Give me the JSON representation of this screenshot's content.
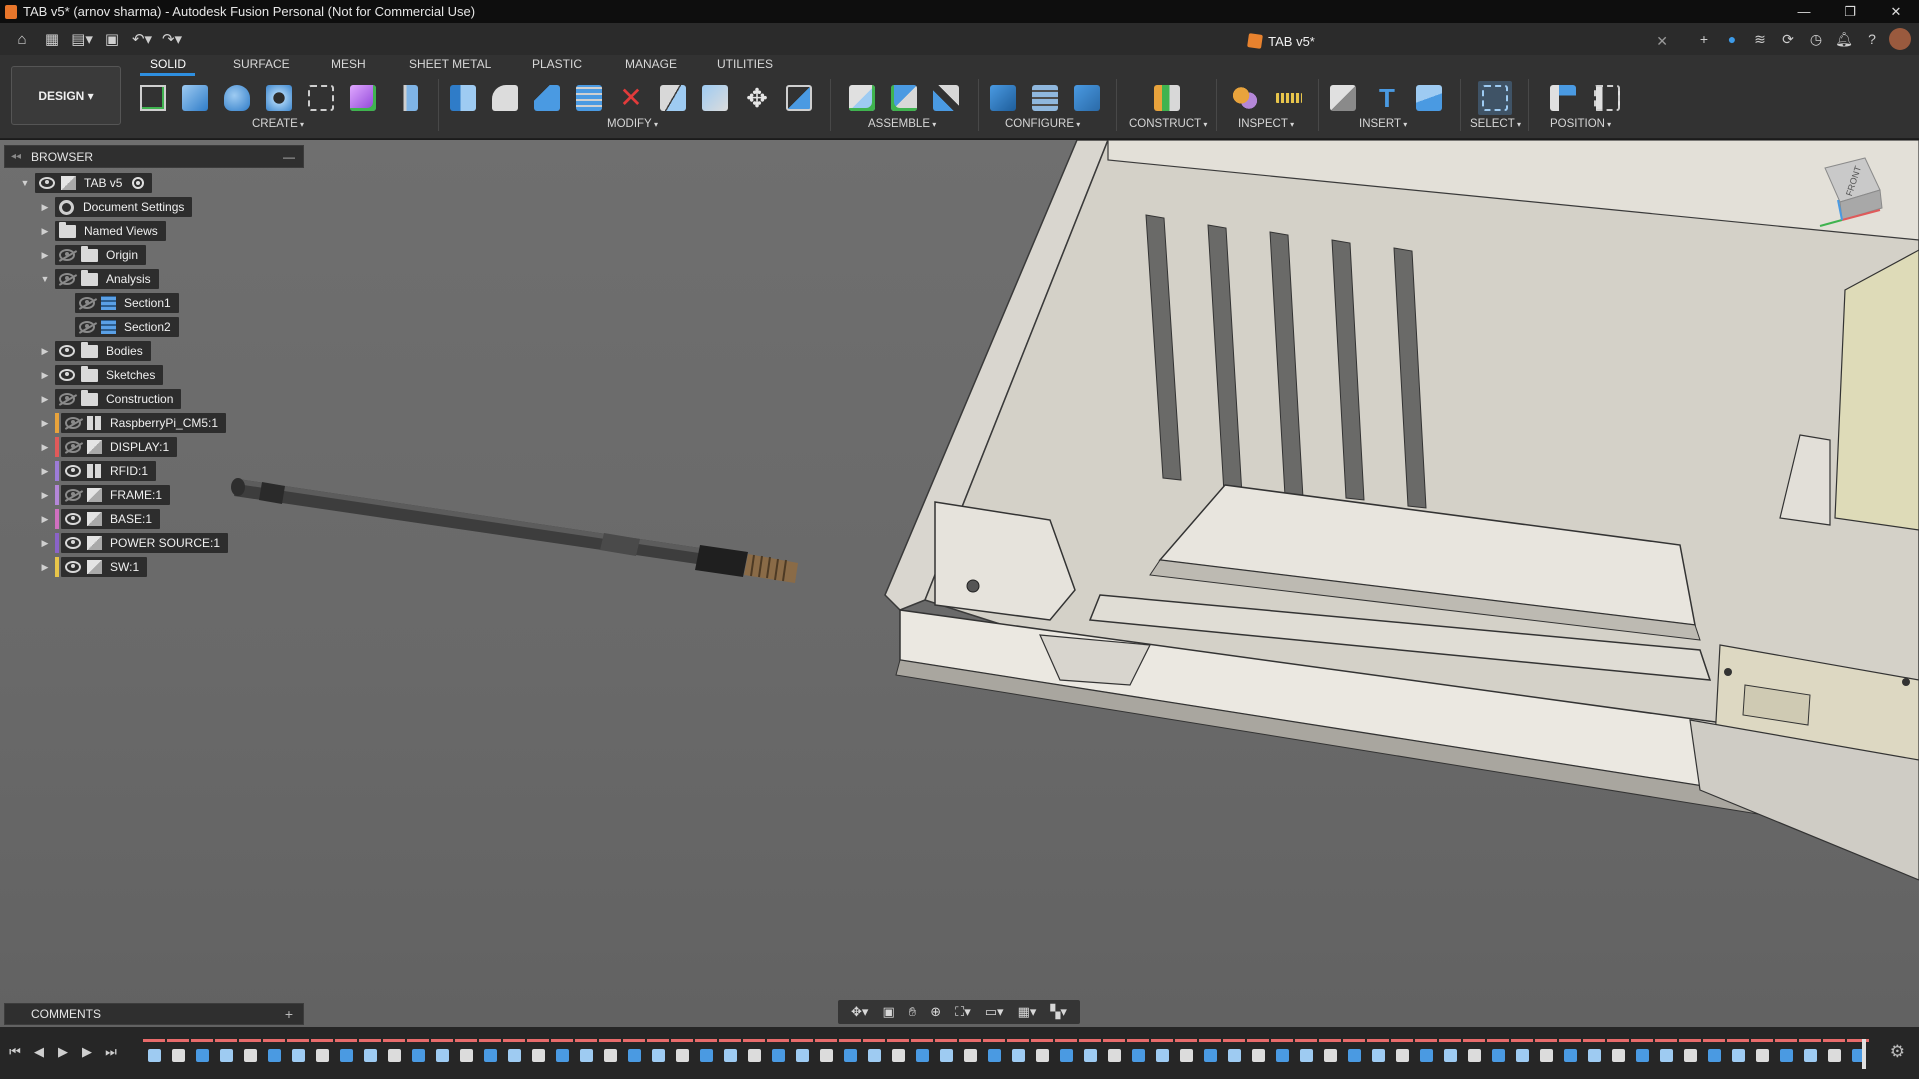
{
  "window": {
    "title": "TAB v5* (arnov sharma) - Autodesk Fusion Personal (Not for Commercial Use)",
    "controls": [
      "—",
      "❐",
      "✕"
    ]
  },
  "tabbar": {
    "document_tab": "TAB v5*",
    "close_glyph": "✕",
    "quick_access_icons": [
      "home-icon",
      "grid-icon",
      "file-icon",
      "save-icon",
      "undo-icon",
      "redo-icon"
    ],
    "right_icons": [
      "add-tab-icon",
      "cloud-icon",
      "job-status-icon",
      "extensions-icon",
      "clock-icon",
      "notifications-icon",
      "help-icon",
      "avatar"
    ]
  },
  "workspace": {
    "label": "DESIGN ▾"
  },
  "ribbon": {
    "tabs": [
      "SOLID",
      "SURFACE",
      "MESH",
      "SHEET METAL",
      "PLASTIC",
      "MANAGE",
      "UTILITIES"
    ],
    "active_tab": "SOLID",
    "groups": [
      "CREATE",
      "MODIFY",
      "ASSEMBLE",
      "CONFIGURE",
      "CONSTRUCT",
      "INSPECT",
      "INSERT",
      "SELECT",
      "POSITION"
    ]
  },
  "browser": {
    "title": "BROWSER",
    "items": [
      {
        "label": "TAB v5",
        "icon": "component-icon"
      },
      {
        "label": "Document Settings",
        "icon": "gear-icon"
      },
      {
        "label": "Named Views",
        "icon": "folder-icon"
      },
      {
        "label": "Origin",
        "icon": "folder-icon"
      },
      {
        "label": "Analysis",
        "icon": "folder-icon"
      },
      {
        "label": "Section1",
        "icon": "section-analysis-icon"
      },
      {
        "label": "Section2",
        "icon": "section-analysis-icon"
      },
      {
        "label": "Bodies",
        "icon": "folder-icon"
      },
      {
        "label": "Sketches",
        "icon": "folder-icon"
      },
      {
        "label": "Construction",
        "icon": "folder-icon"
      },
      {
        "label": "RaspberryPi_CM5:1",
        "icon": "assembly-icon"
      },
      {
        "label": "DISPLAY:1",
        "icon": "component-icon"
      },
      {
        "label": "RFID:1",
        "icon": "assembly-icon"
      },
      {
        "label": "FRAME:1",
        "icon": "component-icon"
      },
      {
        "label": "BASE:1",
        "icon": "component-icon"
      },
      {
        "label": "POWER SOURCE:1",
        "icon": "component-icon"
      },
      {
        "label": "SW:1",
        "icon": "component-icon"
      }
    ]
  },
  "comments": {
    "title": "COMMENTS",
    "add_glyph": "+"
  },
  "viewcube": {
    "face_label": "FRONT"
  },
  "colors": {
    "accent": "#2e8fe0",
    "stripe_raspberry": "#e8a33c",
    "stripe_display": "#e05a5a",
    "stripe_rfid": "#9d7cd8",
    "stripe_frame": "#b487d8",
    "stripe_base": "#d070c0",
    "stripe_power": "#8a63c8",
    "stripe_sw": "#e8c54a"
  }
}
